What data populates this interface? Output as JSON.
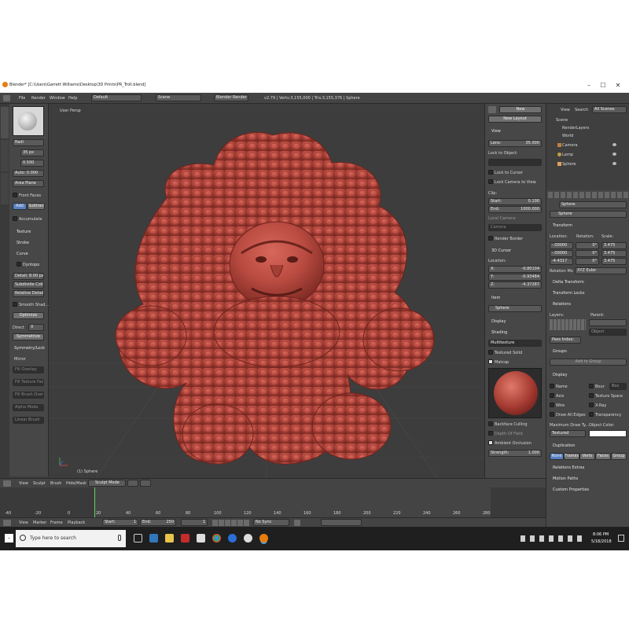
{
  "window": {
    "title": "Blender* [C:\\Users\\Garrett Williams\\Desktop\\3D Prints\\PR_Troll.blend]",
    "controls": {
      "minimize": "–",
      "maximize": "☐",
      "close": "✕"
    }
  },
  "menubar": {
    "items": [
      "File",
      "Render",
      "Window",
      "Help"
    ],
    "layout": "Default",
    "scene": "Scene",
    "engine": "Blender Render",
    "stats": "v2.79 | Verts:3,155,000 | Tris:3,155,376 | Sphere"
  },
  "toolshelf": {
    "radius_label": "Radi",
    "radius_value": "35 px",
    "strength_value": "0.500",
    "autosmooth": "Auto: 0.000",
    "brush_type": "Area Plane",
    "front_faces": "Front Faces",
    "add_label": "Add",
    "subtract_label": "Subtract",
    "accumulate": "Accumulate",
    "sections": [
      "Texture",
      "Stroke",
      "Curve"
    ],
    "dyntopo": "Dyntopo",
    "detail": "Detail: 8.00 px",
    "subdivide": "Subdivide Coll...",
    "relative": "Relative Detail",
    "smooth_shading": "Smooth Shad...",
    "optimize": "Optimize",
    "direct": "Direct",
    "axis": "X",
    "symmetrize": "Symmetrize",
    "symmetry": "Symmetry/Lock",
    "mirror": "Mirror",
    "misc_fields": [
      "Fill Overlay",
      "Fill Texture Fade",
      "Fill Brush Overlay",
      "Alpha Mode",
      "Linear Brush"
    ]
  },
  "viewport": {
    "label": "User Persp",
    "object_label": "(1) Sphere",
    "subject": "sculpted troll creature",
    "color": "#b84a40"
  },
  "npanel": {
    "new": "New",
    "new_layout": "New Layout",
    "view": "View",
    "lens": "Lens:",
    "lens_value": "35.000",
    "lock_to_object": "Lock to Object:",
    "lock_to_cursor": "Lock to Cursor",
    "lock_camera": "Lock Camera to View",
    "clip": "Clip:",
    "clip_start": "Start:",
    "clip_start_value": "0.100",
    "clip_end": "End:",
    "clip_end_value": "1000.000",
    "local_camera": "Local Camera:",
    "camera": "Camera",
    "render_border": "Render Border",
    "cursor": "3D Cursor",
    "location": "Location:",
    "x": "X:",
    "x_value": "-0.80104",
    "y": "Y:",
    "y_value": "-0.93484",
    "z": "Z:",
    "z_value": "-4.37287",
    "item": "Item",
    "sphere": "Sphere",
    "display": "Display",
    "shading": "Shading",
    "multitexture": "Multitexture",
    "textured_solid": "Textured Solid",
    "matcap": "Matcap",
    "backface": "Backface Culling",
    "depth_of_field": "Depth Of Field",
    "ambient_occlusion": "Ambient Occlusion",
    "strength": "Strength:",
    "strength_value": "1.000"
  },
  "outliner": {
    "view": "View",
    "search": "Search",
    "all_scenes": "All Scenes",
    "items": [
      "Scene",
      "RenderLayers",
      "World",
      "Camera",
      "Lamp",
      "Sphere"
    ]
  },
  "properties": {
    "object_name": "Sphere",
    "sections": {
      "transform": "Transform",
      "delta": "Delta Transform",
      "locks": "Transform Locks",
      "relations": "Relations",
      "groups": "Groups",
      "display": "Display",
      "duplication": "Duplication",
      "relations_extras": "Relations Extras",
      "motion_paths": "Motion Paths",
      "custom": "Custom Properties"
    },
    "location": "Location:",
    "rotation": "Rotation:",
    "scale": "Scale:",
    "loc": [
      "-.00000",
      "-.00000",
      "-4.4317"
    ],
    "rot": [
      "0°",
      "0°",
      "0°"
    ],
    "scl": [
      "3.475",
      "3.475",
      "3.475"
    ],
    "rotation_mode": "Rotation Mo",
    "rotation_mode_value": "XYZ Euler",
    "layers": "Layers:",
    "parent": "Parent:",
    "object": "Object",
    "pass_index": "Pass Index:",
    "add_to_group": "Add to Group",
    "display_checks": [
      "Name",
      "Axis",
      "Wire",
      "Draw All Edges",
      "Bour",
      "Texture Space",
      "X-Ray",
      "Transparency"
    ],
    "bounds_value": "Box",
    "max_draw": "Maximum Draw Ty...",
    "object_color": "Object Color:",
    "textured": "Textured",
    "dup_tabs": [
      "None",
      "Frames",
      "Verts",
      "Faces",
      "Group"
    ]
  },
  "viewport_header": {
    "items": [
      "View",
      "Sculpt",
      "Brush",
      "Hide/Mask"
    ],
    "mode": "Sculpt Mode"
  },
  "timeline": {
    "ticks": [
      "-40",
      "-20",
      "0",
      "20",
      "40",
      "60",
      "80",
      "100",
      "120",
      "140",
      "160",
      "180",
      "200",
      "220",
      "240",
      "260",
      "280"
    ],
    "menu": [
      "View",
      "Marker",
      "Frame",
      "Playback"
    ],
    "start_label": "Start:",
    "start_value": "1",
    "end_label": "End:",
    "end_value": "250",
    "current": "1",
    "sync": "No Sync"
  },
  "taskbar": {
    "search_placeholder": "Type here to search",
    "time": "8:06 PM",
    "date": "5/18/2018"
  },
  "colors": {
    "accent": "#5680c2",
    "troll": "#b84a40",
    "panel": "#474747",
    "viewport_bg": "#3d3d3d"
  }
}
